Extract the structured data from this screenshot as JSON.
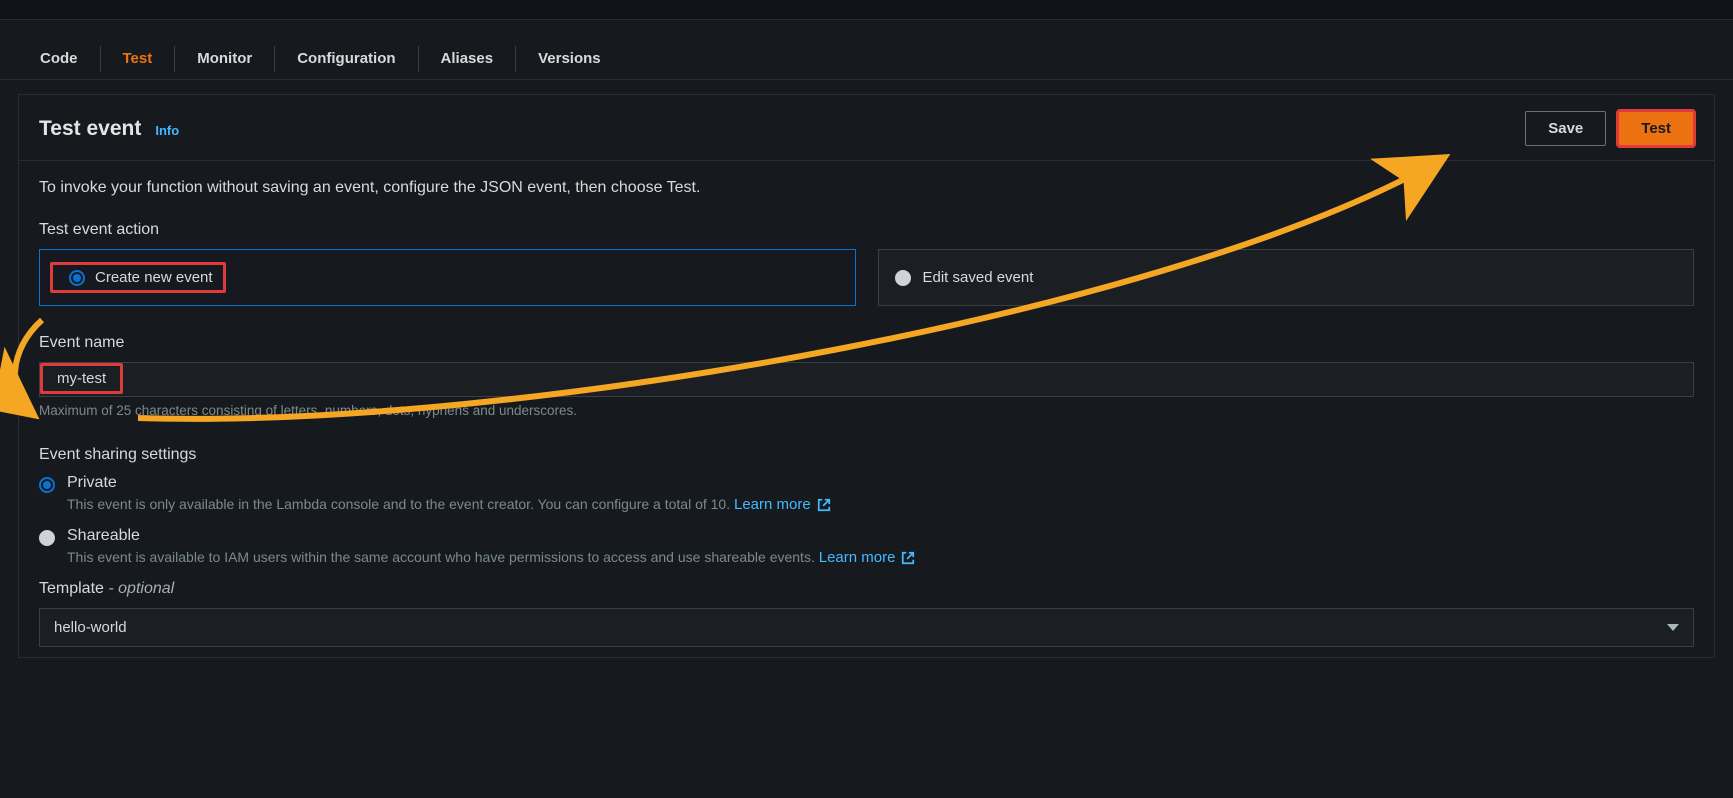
{
  "tabs": {
    "code": "Code",
    "test": "Test",
    "monitor": "Monitor",
    "configuration": "Configuration",
    "aliases": "Aliases",
    "versions": "Versions"
  },
  "header": {
    "title": "Test event",
    "info": "Info",
    "save": "Save",
    "test": "Test"
  },
  "desc": "To invoke your function without saving an event, configure the JSON event, then choose Test.",
  "action": {
    "label": "Test event action",
    "create": "Create new event",
    "edit": "Edit saved event"
  },
  "eventName": {
    "label": "Event name",
    "value": "my-test",
    "hint": "Maximum of 25 characters consisting of letters, numbers, dots, hyphens and underscores."
  },
  "sharing": {
    "label": "Event sharing settings",
    "private": {
      "title": "Private",
      "desc": "This event is only available in the Lambda console and to the event creator. You can configure a total of 10.",
      "learn": "Learn more"
    },
    "shareable": {
      "title": "Shareable",
      "desc": "This event is available to IAM users within the same account who have permissions to access and use shareable events.",
      "learn": "Learn more"
    }
  },
  "template": {
    "label": "Template",
    "optional": "- optional",
    "value": "hello-world"
  }
}
